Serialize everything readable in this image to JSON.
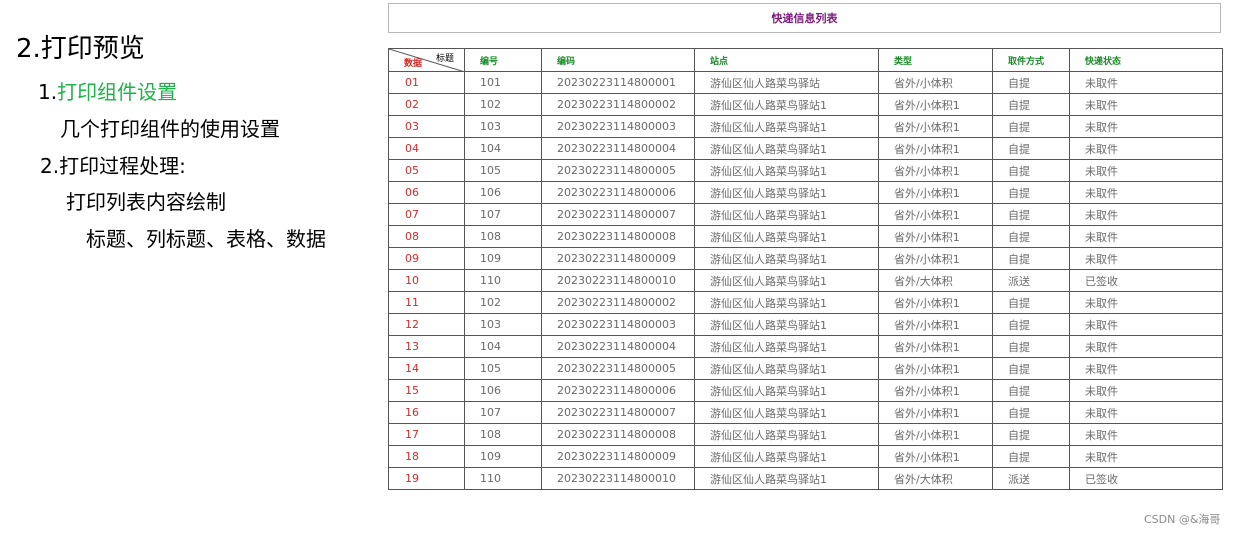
{
  "outline": {
    "heading": "2.打印预览",
    "item1_prefix": "1.",
    "item1_highlight": "打印组件设置",
    "item1_desc": "几个打印组件的使用设置",
    "item2": "2.打印过程处理:",
    "item2_sub": "打印列表内容绘制",
    "item2_detail": "标题、列标题、表格、数据"
  },
  "table": {
    "title": "快递信息列表",
    "corner_top": "标题",
    "corner_bottom": "数据",
    "columns": [
      "编号",
      "编码",
      "站点",
      "类型",
      "取件方式",
      "快递状态"
    ],
    "rows": [
      [
        "01",
        "101",
        "20230223114800001",
        "游仙区仙人路菜鸟驿站",
        "省外/小体积",
        "自提",
        "未取件"
      ],
      [
        "02",
        "102",
        "20230223114800002",
        "游仙区仙人路菜鸟驿站1",
        "省外/小体积1",
        "自提",
        "未取件"
      ],
      [
        "03",
        "103",
        "20230223114800003",
        "游仙区仙人路菜鸟驿站1",
        "省外/小体积1",
        "自提",
        "未取件"
      ],
      [
        "04",
        "104",
        "20230223114800004",
        "游仙区仙人路菜鸟驿站1",
        "省外/小体积1",
        "自提",
        "未取件"
      ],
      [
        "05",
        "105",
        "20230223114800005",
        "游仙区仙人路菜鸟驿站1",
        "省外/小体积1",
        "自提",
        "未取件"
      ],
      [
        "06",
        "106",
        "20230223114800006",
        "游仙区仙人路菜鸟驿站1",
        "省外/小体积1",
        "自提",
        "未取件"
      ],
      [
        "07",
        "107",
        "20230223114800007",
        "游仙区仙人路菜鸟驿站1",
        "省外/小体积1",
        "自提",
        "未取件"
      ],
      [
        "08",
        "108",
        "20230223114800008",
        "游仙区仙人路菜鸟驿站1",
        "省外/小体积1",
        "自提",
        "未取件"
      ],
      [
        "09",
        "109",
        "20230223114800009",
        "游仙区仙人路菜鸟驿站1",
        "省外/小体积1",
        "自提",
        "未取件"
      ],
      [
        "10",
        "110",
        "20230223114800010",
        "游仙区仙人路菜鸟驿站1",
        "省外/大体积",
        "派送",
        "已签收"
      ],
      [
        "11",
        "102",
        "20230223114800002",
        "游仙区仙人路菜鸟驿站1",
        "省外/小体积1",
        "自提",
        "未取件"
      ],
      [
        "12",
        "103",
        "20230223114800003",
        "游仙区仙人路菜鸟驿站1",
        "省外/小体积1",
        "自提",
        "未取件"
      ],
      [
        "13",
        "104",
        "20230223114800004",
        "游仙区仙人路菜鸟驿站1",
        "省外/小体积1",
        "自提",
        "未取件"
      ],
      [
        "14",
        "105",
        "20230223114800005",
        "游仙区仙人路菜鸟驿站1",
        "省外/小体积1",
        "自提",
        "未取件"
      ],
      [
        "15",
        "106",
        "20230223114800006",
        "游仙区仙人路菜鸟驿站1",
        "省外/小体积1",
        "自提",
        "未取件"
      ],
      [
        "16",
        "107",
        "20230223114800007",
        "游仙区仙人路菜鸟驿站1",
        "省外/小体积1",
        "自提",
        "未取件"
      ],
      [
        "17",
        "108",
        "20230223114800008",
        "游仙区仙人路菜鸟驿站1",
        "省外/小体积1",
        "自提",
        "未取件"
      ],
      [
        "18",
        "109",
        "20230223114800009",
        "游仙区仙人路菜鸟驿站1",
        "省外/小体积1",
        "自提",
        "未取件"
      ],
      [
        "19",
        "110",
        "20230223114800010",
        "游仙区仙人路菜鸟驿站1",
        "省外/大体积",
        "派送",
        "已签收"
      ]
    ]
  },
  "watermark": "CSDN @&海哥"
}
